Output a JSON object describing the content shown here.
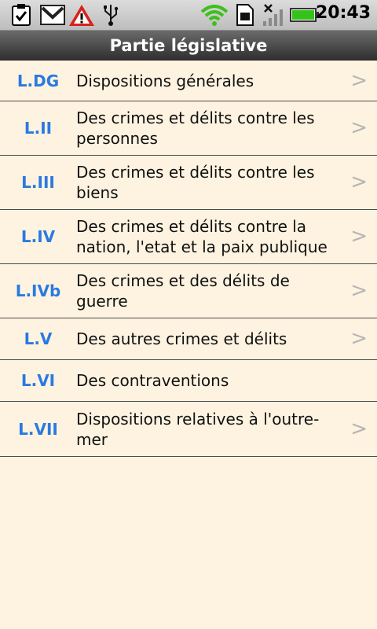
{
  "status_bar": {
    "time": "20:43",
    "icons": [
      "clipboard-icon",
      "gmail-icon",
      "warning-icon",
      "usb-icon",
      "wifi-icon",
      "sim-icon",
      "no-signal-icon",
      "battery-icon"
    ],
    "colors": {
      "wifi": "#3fbf1f",
      "warning": "#d7231c",
      "battery": "#35c21b"
    }
  },
  "header": {
    "title": "Partie législative"
  },
  "items": [
    {
      "code": "L.DG",
      "label": "Dispositions générales",
      "has_chevron": true
    },
    {
      "code": "L.II",
      "label": "Des crimes et délits contre les personnes",
      "has_chevron": true
    },
    {
      "code": "L.III",
      "label": "Des crimes et délits contre les biens",
      "has_chevron": true
    },
    {
      "code": "L.IV",
      "label": "Des crimes et délits contre la nation, l'etat et la paix publique",
      "has_chevron": true
    },
    {
      "code": "L.IVb",
      "label": "Des crimes et des délits de guerre",
      "has_chevron": true
    },
    {
      "code": "L.V",
      "label": "Des autres crimes et délits",
      "has_chevron": true
    },
    {
      "code": "L.VI",
      "label": "Des contraventions",
      "has_chevron": false
    },
    {
      "code": "L.VII",
      "label": "Dispositions relatives à l'outre-mer",
      "has_chevron": true
    }
  ],
  "chevron_glyph": ">",
  "colors": {
    "background": "#fdf3e0",
    "code": "#2a7ae0",
    "chevron": "#b5b5b5"
  }
}
